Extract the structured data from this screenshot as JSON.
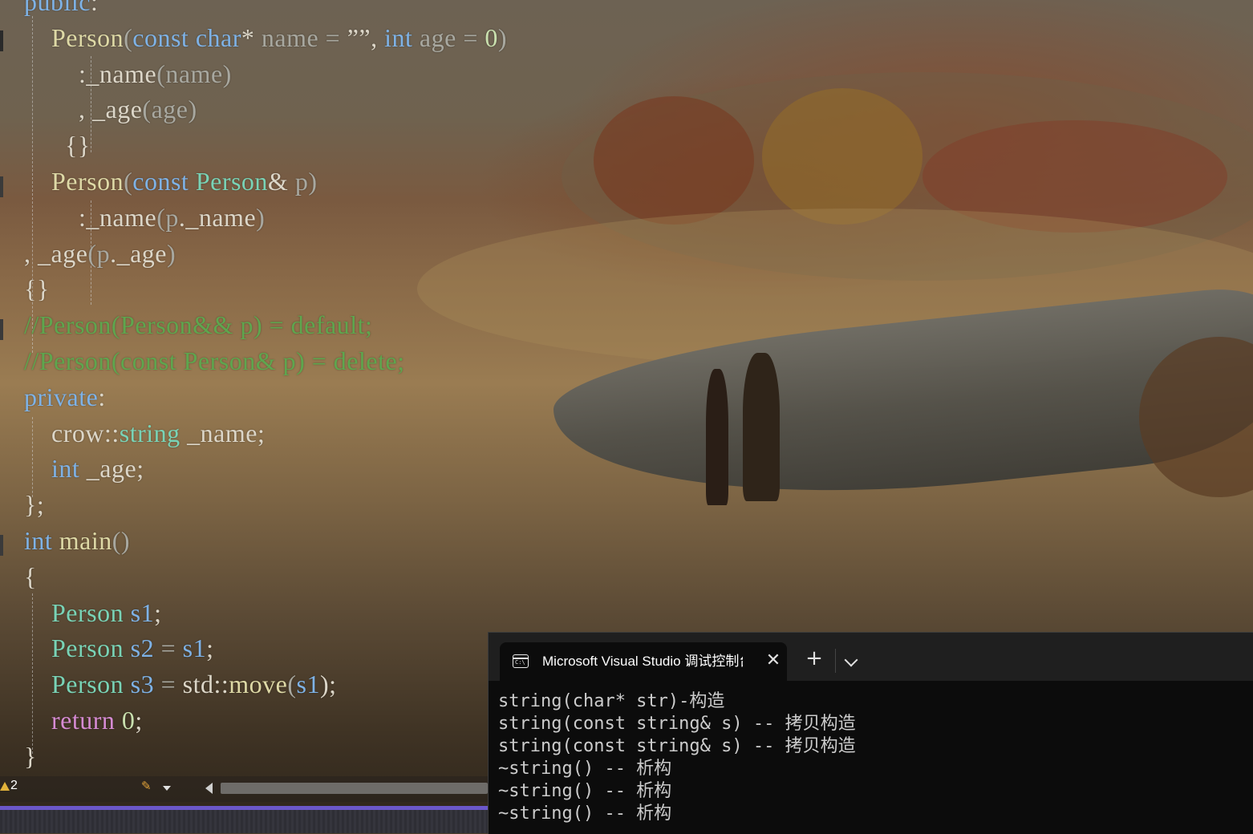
{
  "code_lines": [
    [
      {
        "t": "public",
        "c": "kw"
      },
      {
        "t": ":",
        "c": "pl"
      }
    ],
    [
      {
        "t": "    "
      },
      {
        "t": "Person",
        "c": "fn"
      },
      {
        "t": "(",
        "c": "gr"
      },
      {
        "t": "const",
        "c": "kw"
      },
      {
        "t": " "
      },
      {
        "t": "char",
        "c": "kw"
      },
      {
        "t": "* ",
        "c": "pl"
      },
      {
        "t": "name",
        "c": "gr"
      },
      {
        "t": " = ",
        "c": "gr"
      },
      {
        "t": "””",
        "c": "pl"
      },
      {
        "t": ", ",
        "c": "pl"
      },
      {
        "t": "int",
        "c": "kw"
      },
      {
        "t": " "
      },
      {
        "t": "age",
        "c": "gr"
      },
      {
        "t": " = ",
        "c": "gr"
      },
      {
        "t": "0",
        "c": "nm"
      },
      {
        "t": ")",
        "c": "gr"
      }
    ],
    [
      {
        "t": "        "
      },
      {
        "t": ":_name",
        "c": "pl"
      },
      {
        "t": "(",
        "c": "gr"
      },
      {
        "t": "name",
        "c": "gr"
      },
      {
        "t": ")",
        "c": "gr"
      }
    ],
    [
      {
        "t": "        "
      },
      {
        "t": ", _age",
        "c": "pl"
      },
      {
        "t": "(",
        "c": "gr"
      },
      {
        "t": "age",
        "c": "gr"
      },
      {
        "t": ")",
        "c": "gr"
      }
    ],
    [
      {
        "t": "      "
      },
      {
        "t": "{}",
        "c": "pl"
      }
    ],
    [
      {
        "t": "    "
      },
      {
        "t": "Person",
        "c": "fn"
      },
      {
        "t": "(",
        "c": "gr"
      },
      {
        "t": "const",
        "c": "kw"
      },
      {
        "t": " "
      },
      {
        "t": "Person",
        "c": "ty"
      },
      {
        "t": "& ",
        "c": "pl"
      },
      {
        "t": "p",
        "c": "gr"
      },
      {
        "t": ")",
        "c": "gr"
      }
    ],
    [
      {
        "t": "        "
      },
      {
        "t": ":_name",
        "c": "pl"
      },
      {
        "t": "(",
        "c": "gr"
      },
      {
        "t": "p",
        "c": "gr"
      },
      {
        "t": "._name",
        "c": "pl"
      },
      {
        "t": ")",
        "c": "gr"
      }
    ],
    [
      {
        "t": ", _age",
        "c": "pl"
      },
      {
        "t": "(",
        "c": "gr"
      },
      {
        "t": "p",
        "c": "gr"
      },
      {
        "t": "._age",
        "c": "pl"
      },
      {
        "t": ")",
        "c": "gr"
      }
    ],
    [
      {
        "t": "{}",
        "c": "pl"
      }
    ],
    [
      {
        "t": "//Person(Person&& p) = default;",
        "c": "cm"
      }
    ],
    [
      {
        "t": "//Person(const Person& p) = delete;",
        "c": "cm"
      }
    ],
    [
      {
        "t": "private",
        "c": "kw"
      },
      {
        "t": ":",
        "c": "pl"
      }
    ],
    [
      {
        "t": "    "
      },
      {
        "t": "crow::",
        "c": "pl"
      },
      {
        "t": "string",
        "c": "ty"
      },
      {
        "t": " _name;",
        "c": "pl"
      }
    ],
    [
      {
        "t": "    "
      },
      {
        "t": "int",
        "c": "kw"
      },
      {
        "t": " _age;",
        "c": "pl"
      }
    ],
    [
      {
        "t": "};",
        "c": "pl"
      }
    ],
    [
      {
        "t": "int",
        "c": "kw"
      },
      {
        "t": " "
      },
      {
        "t": "main",
        "c": "fn"
      },
      {
        "t": "()",
        "c": "gr"
      }
    ],
    [
      {
        "t": "{",
        "c": "pl"
      }
    ],
    [
      {
        "t": "    "
      },
      {
        "t": "Person",
        "c": "ty"
      },
      {
        "t": " "
      },
      {
        "t": "s1",
        "c": "kw"
      },
      {
        "t": ";",
        "c": "pl"
      }
    ],
    [
      {
        "t": "    "
      },
      {
        "t": "Person",
        "c": "ty"
      },
      {
        "t": " "
      },
      {
        "t": "s2",
        "c": "kw"
      },
      {
        "t": " = ",
        "c": "gr"
      },
      {
        "t": "s1",
        "c": "kw"
      },
      {
        "t": ";",
        "c": "pl"
      }
    ],
    [
      {
        "t": "    "
      },
      {
        "t": "Person",
        "c": "ty"
      },
      {
        "t": " "
      },
      {
        "t": "s3",
        "c": "kw"
      },
      {
        "t": " = ",
        "c": "gr"
      },
      {
        "t": "std::",
        "c": "pl"
      },
      {
        "t": "move",
        "c": "fn"
      },
      {
        "t": "(",
        "c": "gr"
      },
      {
        "t": "s1",
        "c": "kw"
      },
      {
        "t": ");",
        "c": "pl"
      }
    ],
    [
      {
        "t": "    "
      },
      {
        "t": "return",
        "c": "pk"
      },
      {
        "t": " "
      },
      {
        "t": "0",
        "c": "nm"
      },
      {
        "t": ";",
        "c": "pl"
      }
    ],
    [
      {
        "t": "}",
        "c": "pl"
      }
    ]
  ],
  "status": {
    "warning_count": "2",
    "warning_icon": "warning-triangle-icon",
    "brush_icon": "code-cleanup-icon"
  },
  "terminal": {
    "tab_title": "Microsoft Visual Studio 调试控制台",
    "tab_icon": "console-icon",
    "close_glyph": "✕",
    "new_tab_glyph": "+",
    "lines": [
      "string(char* str)-构造",
      "string(const string& s) -- 拷贝构造",
      "string(const string& s) -- 拷贝构造",
      "~string() -- 析构",
      "~string() -- 析构",
      "~string() -- 析构"
    ]
  },
  "colors": {
    "keyword": "#7eb2e6",
    "type": "#79d3b6",
    "function": "#ded9a6",
    "comment": "#5ea64e",
    "control": "#d68bd3",
    "accent_bar": "#6b57c8",
    "terminal_bg": "#0c0c0c"
  }
}
